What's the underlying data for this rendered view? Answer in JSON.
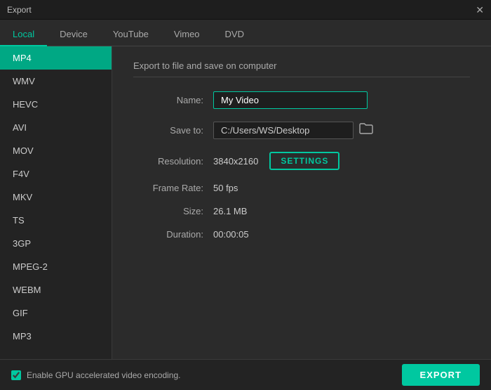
{
  "titlebar": {
    "title": "Export",
    "close_label": "✕"
  },
  "tabs": [
    {
      "id": "local",
      "label": "Local",
      "active": true
    },
    {
      "id": "device",
      "label": "Device",
      "active": false
    },
    {
      "id": "youtube",
      "label": "YouTube",
      "active": false
    },
    {
      "id": "vimeo",
      "label": "Vimeo",
      "active": false
    },
    {
      "id": "dvd",
      "label": "DVD",
      "active": false
    }
  ],
  "sidebar": {
    "items": [
      {
        "id": "mp4",
        "label": "MP4",
        "active": true
      },
      {
        "id": "wmv",
        "label": "WMV",
        "active": false
      },
      {
        "id": "hevc",
        "label": "HEVC",
        "active": false
      },
      {
        "id": "avi",
        "label": "AVI",
        "active": false
      },
      {
        "id": "mov",
        "label": "MOV",
        "active": false
      },
      {
        "id": "f4v",
        "label": "F4V",
        "active": false
      },
      {
        "id": "mkv",
        "label": "MKV",
        "active": false
      },
      {
        "id": "ts",
        "label": "TS",
        "active": false
      },
      {
        "id": "3gp",
        "label": "3GP",
        "active": false
      },
      {
        "id": "mpeg2",
        "label": "MPEG-2",
        "active": false
      },
      {
        "id": "webm",
        "label": "WEBM",
        "active": false
      },
      {
        "id": "gif",
        "label": "GIF",
        "active": false
      },
      {
        "id": "mp3",
        "label": "MP3",
        "active": false
      }
    ]
  },
  "content": {
    "section_title": "Export to file and save on computer",
    "fields": {
      "name_label": "Name:",
      "name_value": "My Video",
      "saveto_label": "Save to:",
      "saveto_value": "C:/Users/WS/Desktop",
      "resolution_label": "Resolution:",
      "resolution_value": "3840x2160",
      "settings_button": "SETTINGS",
      "framerate_label": "Frame Rate:",
      "framerate_value": "50 fps",
      "size_label": "Size:",
      "size_value": "26.1 MB",
      "duration_label": "Duration:",
      "duration_value": "00:00:05"
    }
  },
  "bottombar": {
    "gpu_label": "Enable GPU accelerated video encoding.",
    "export_button": "EXPORT"
  },
  "icons": {
    "folder": "🗁",
    "close": "✕"
  }
}
